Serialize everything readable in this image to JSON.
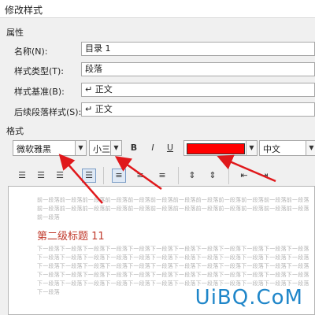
{
  "window": {
    "title": "修改样式"
  },
  "properties": {
    "section_label": "属性",
    "name": {
      "label": "名称(N):",
      "value": "目录 1"
    },
    "style_type": {
      "label": "样式类型(T):",
      "value": "段落"
    },
    "based_on": {
      "label": "样式基准(B):",
      "value": "↵ 正文"
    },
    "next_style": {
      "label": "后续段落样式(S):",
      "value": "↵ 正文"
    }
  },
  "format": {
    "section_label": "格式",
    "font": "微软雅黑",
    "size": "小三",
    "bold": "B",
    "italic": "I",
    "underline": "U",
    "font_color": "#ff0000",
    "language": "中文"
  },
  "preview": {
    "prev_paragraph_lines": [
      "前一段落前一段落前一段落前一段落前一段落前一段落前一段落前一段落前一段落前一段落前一段落前一段落",
      "前一段落前一段落前一段落前一段落前一段落前一段落前一段落前一段落前一段落前一段落前一段落前一段落",
      "前一段落"
    ],
    "heading": "第二级标题 11",
    "next_paragraph_lines": [
      "下一段落下一段落下一段落下一段落下一段落下一段落下一段落下一段落下一段落下一段落下一段落下一段落",
      "下一段落下一段落下一段落下一段落下一段落下一段落下一段落下一段落下一段落下一段落下一段落下一段落",
      "下一段落下一段落下一段落下一段落下一段落下一段落下一段落下一段落下一段落下一段落下一段落下一段落",
      "下一段落下一段落下一段落下一段落下一段落下一段落下一段落下一段落下一段落下一段落下一段落下一段落",
      "下一段落下一段落下一段落下一段落下一段落下一段落下一段落下一段落下一段落下一段落下一段落下一段落",
      "下一段落"
    ]
  },
  "watermark": "UiBQ.CoM",
  "icons": {
    "dropdown": "chevron-down-icon",
    "align": [
      "align-left-icon",
      "align-center-icon",
      "align-right-icon",
      "align-justify-icon"
    ],
    "arrows": "red-annotation-arrow-icon"
  }
}
